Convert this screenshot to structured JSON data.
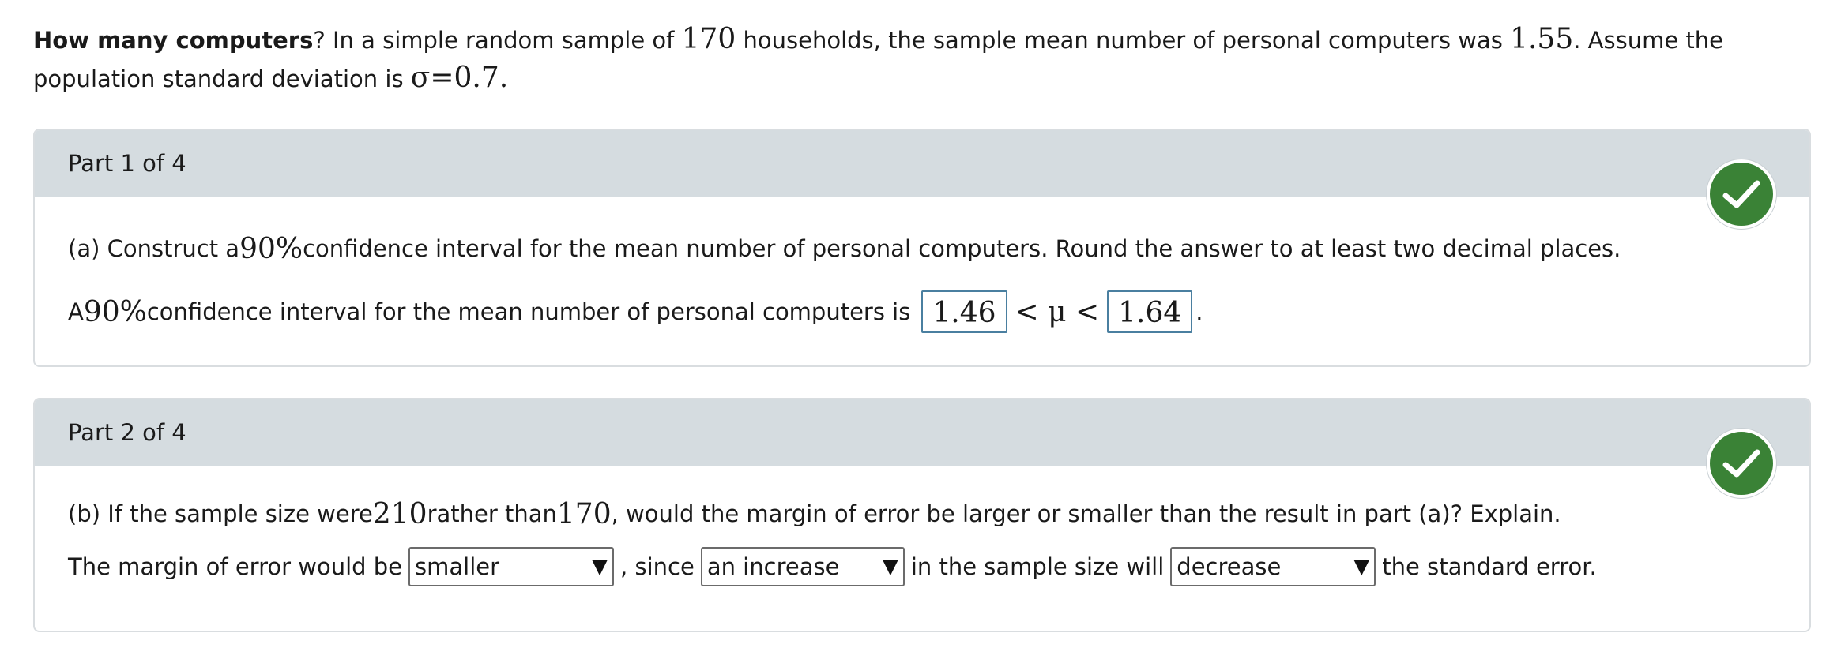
{
  "intro": {
    "title": "How many computers",
    "q_mark": "?",
    "text_1": " In a simple random sample of ",
    "n": "170",
    "text_2": " households, the sample mean number of personal computers was ",
    "mean": "1.55",
    "text_3": ". Assume the population standard deviation is ",
    "sigma": "σ=0.7",
    "text_4": "."
  },
  "part1": {
    "header": "Part 1 of 4",
    "q_prefix": "(a) Construct a ",
    "q_pct": "90%",
    "q_suffix": " confidence interval for the mean number of personal computers. Round the answer to at least two decimal places.",
    "a_prefix": "A ",
    "a_pct": "90%",
    "a_text": " confidence interval for the mean number of personal computers is",
    "lower": "1.46",
    "mu_expr": "< μ <",
    "upper": "1.64",
    "end": "."
  },
  "part2": {
    "header": "Part 2 of 4",
    "q_1": "(b) If the sample size were ",
    "q_n1": "210",
    "q_2": " rather than ",
    "q_n2": "170",
    "q_3": ", would the margin of error be larger or smaller than the result in part (a)? Explain.",
    "a_1": "The margin of error would be",
    "sel_1": "smaller",
    "a_2": ", since",
    "sel_2": "an increase",
    "a_3": "in the sample size will",
    "sel_3": "decrease",
    "a_4": "the standard error."
  },
  "colors": {
    "check_green": "#3a8236",
    "header_bg": "#d5dce0"
  },
  "icons": {
    "check": "check-icon",
    "dropdown": "triangle-down-icon"
  }
}
